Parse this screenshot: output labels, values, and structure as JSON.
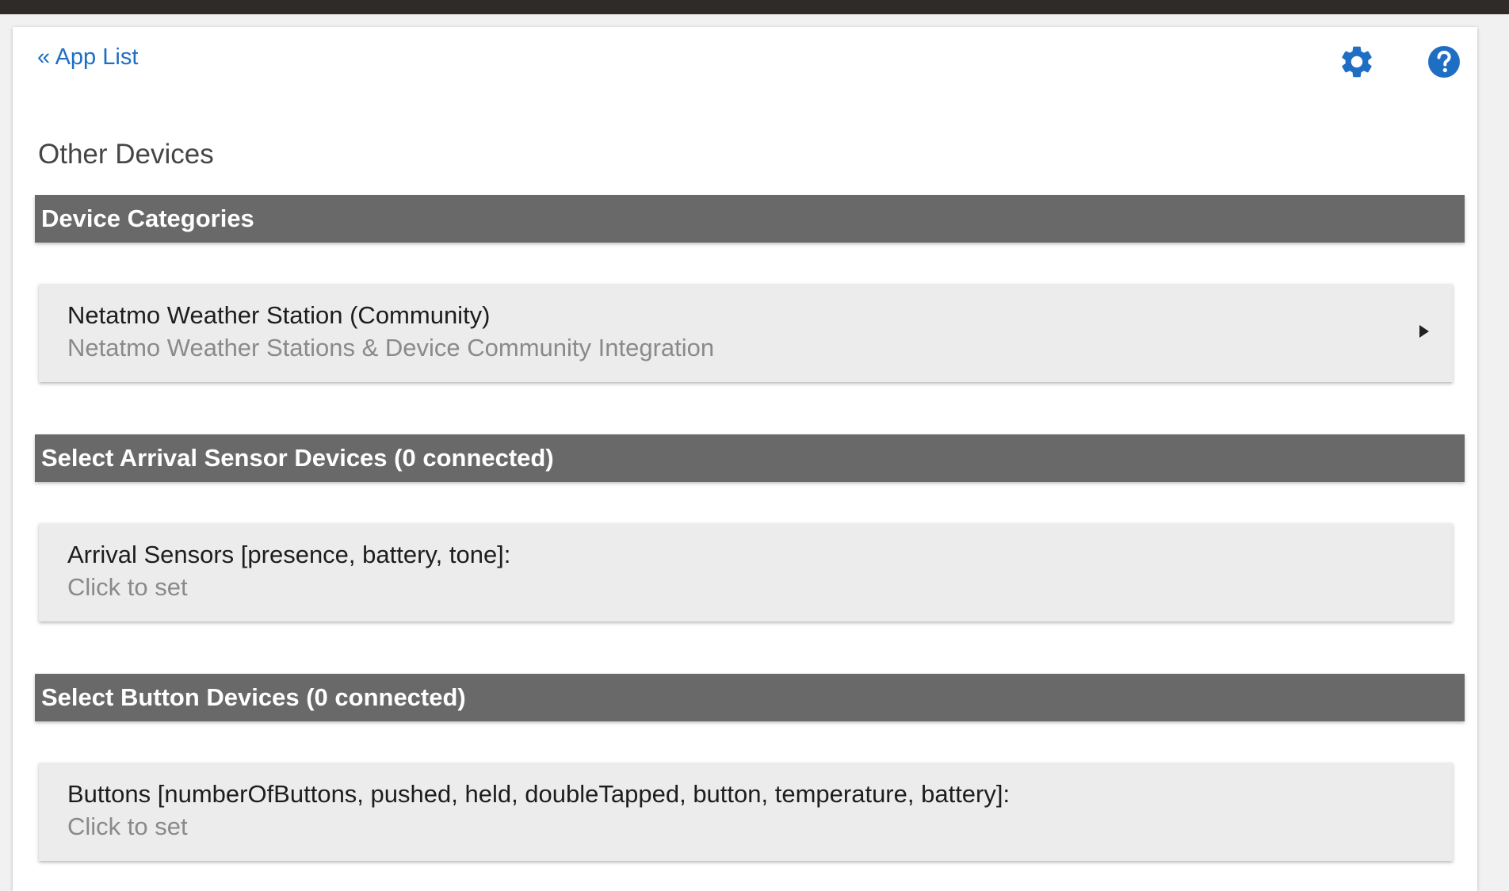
{
  "nav": {
    "back_label": "« App List"
  },
  "toolbar": {
    "settings_icon": "gear-icon",
    "help_icon": "help-icon",
    "icon_color": "#1e6fc4"
  },
  "page": {
    "title": "Other Devices"
  },
  "sections": [
    {
      "header": "Device Categories",
      "row": {
        "title": "Netatmo Weather Station (Community)",
        "subtitle": "Netatmo Weather Stations & Device Community Integration",
        "has_arrow": true
      }
    },
    {
      "header": "Select Arrival Sensor Devices (0 connected)",
      "row": {
        "title": "Arrival Sensors [presence, battery, tone]:",
        "subtitle": "Click to set"
      }
    },
    {
      "header": "Select Button Devices (0 connected)",
      "row": {
        "title": "Buttons [numberOfButtons, pushed, held, doubleTapped, button, temperature, battery]:",
        "subtitle": "Click to set"
      }
    }
  ],
  "colors": {
    "header_bg": "#696969",
    "row_bg": "#ececec",
    "topbar": "#2f2b29",
    "link": "#1e6fc4"
  }
}
